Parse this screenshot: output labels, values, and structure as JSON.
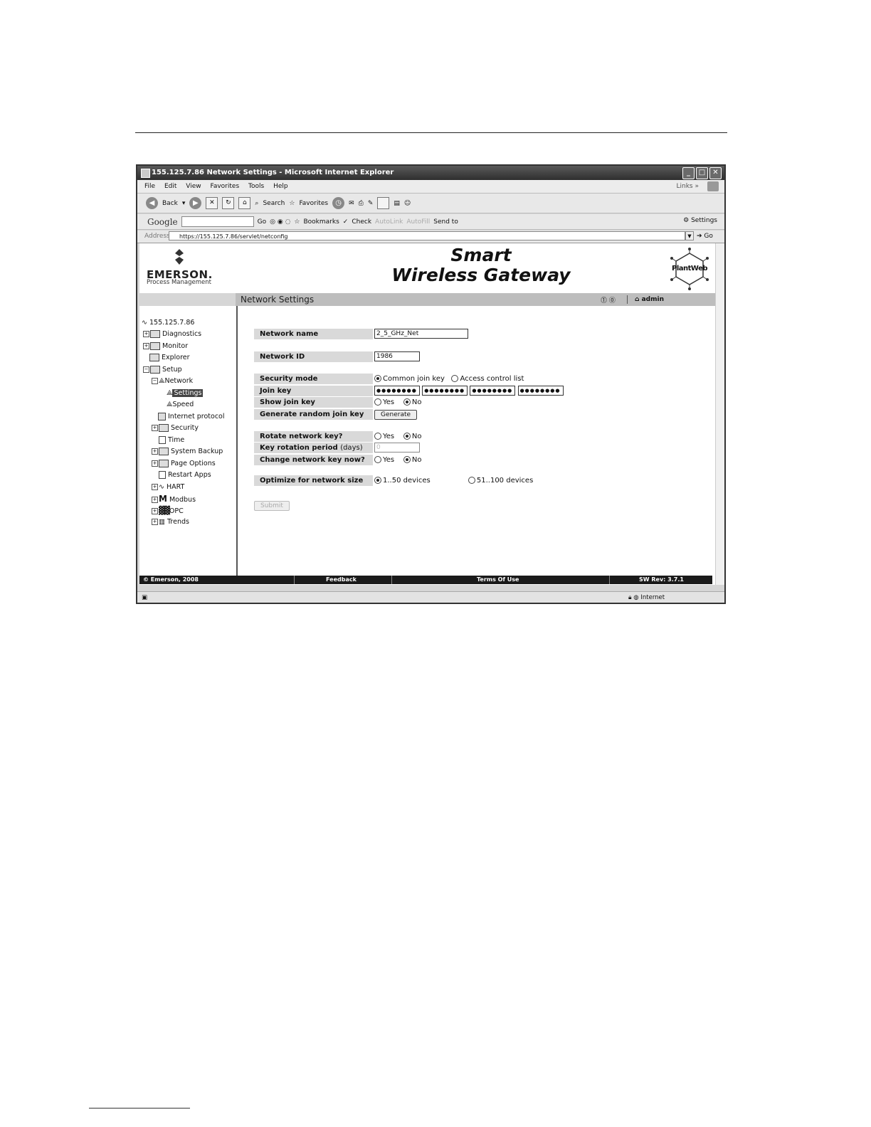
{
  "window": {
    "title": "155.125.7.86 Network Settings - Microsoft Internet Explorer"
  },
  "menu": {
    "items": [
      "File",
      "Edit",
      "View",
      "Favorites",
      "Tools",
      "Help"
    ],
    "links": "Links"
  },
  "toolbar": {
    "back": "Back",
    "search": "Search",
    "favorites": "Favorites"
  },
  "googlebar": {
    "google": "Google",
    "go": "Go",
    "bookmarks": "Bookmarks",
    "check": "Check",
    "autolink": "AutoLink",
    "autofill": "AutoFill",
    "sendto": "Send to",
    "settings": "Settings"
  },
  "address": {
    "label": "Address",
    "url": "https://155.125.7.86/servlet/netconfig",
    "go": "Go"
  },
  "brand": {
    "company": "EMERSON.",
    "division": "Process Management",
    "product_line1": "Smart",
    "product_line2": "Wireless Gateway",
    "plantweb": "PlantWeb"
  },
  "header": {
    "page_title": "Network Settings",
    "user": "admin"
  },
  "sidebar": {
    "root": "155.125.7.86",
    "items": [
      "Diagnostics",
      "Monitor",
      "Explorer",
      "Setup",
      "Network",
      "Settings",
      "Speed",
      "Internet protocol",
      "Security",
      "Time",
      "System Backup",
      "Page Options",
      "Restart Apps",
      "HART",
      "Modbus",
      "OPC",
      "Trends"
    ]
  },
  "form": {
    "network_name": {
      "label": "Network name",
      "value": "2_5_GHz_Net"
    },
    "network_id": {
      "label": "Network ID",
      "value": "1986"
    },
    "security_mode": {
      "label": "Security mode",
      "options": [
        "Common join key",
        "Access control list"
      ],
      "selected": "Common join key"
    },
    "join_key": {
      "label": "Join key",
      "values": [
        "●●●●●●●●",
        "●●●●●●●●",
        "●●●●●●●●",
        "●●●●●●●●"
      ]
    },
    "show_join_key": {
      "label": "Show join key",
      "yes": "Yes",
      "no": "No",
      "selected": "No"
    },
    "generate_key": {
      "label": "Generate random join key",
      "button": "Generate"
    },
    "rotate_key": {
      "label": "Rotate network key?",
      "yes": "Yes",
      "no": "No",
      "selected": "No"
    },
    "rotation_period": {
      "label": "Key rotation period",
      "unit": "(days)",
      "value": "0"
    },
    "change_key_now": {
      "label": "Change network key now?",
      "yes": "Yes",
      "no": "No",
      "selected": "No"
    },
    "optimize": {
      "label": "Optimize for network size",
      "options": [
        "1..50 devices",
        "51..100 devices"
      ],
      "selected": "1..50 devices"
    },
    "submit": "Submit"
  },
  "footer": {
    "copyright": "© Emerson, 2008",
    "feedback": "Feedback",
    "terms": "Terms Of Use",
    "revision": "SW Rev: 3.7.1"
  },
  "statusbar": {
    "zone": "Internet"
  }
}
